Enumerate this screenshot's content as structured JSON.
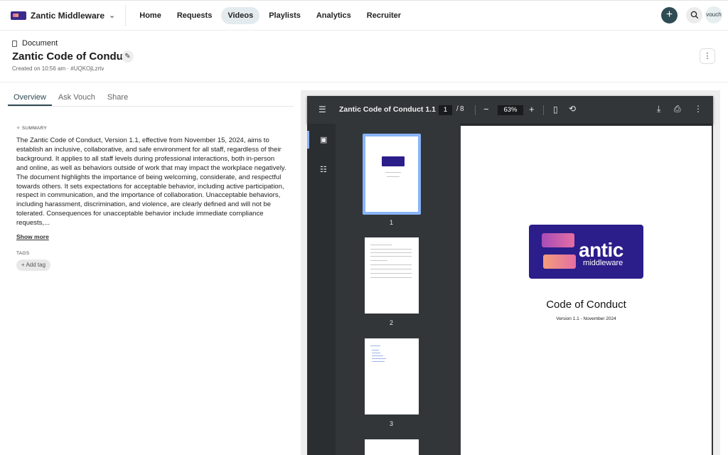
{
  "nav": {
    "brand": "Zantic Middleware",
    "links": [
      "Home",
      "Requests",
      "Videos",
      "Playlists",
      "Analytics",
      "Recruiter"
    ],
    "active": "Videos",
    "avatar": "vouch"
  },
  "header": {
    "type_label": "Document",
    "title": "Zantic Code of Conduct",
    "meta": "Created on 10:56 am · #UQKOjLzrtv"
  },
  "tabs": [
    "Overview",
    "Ask Vouch",
    "Share"
  ],
  "summary": {
    "label": "SUMMARY",
    "text": "The Zantic Code of Conduct, Version 1.1, effective from November 15, 2024, aims to establish an inclusive, collaborative, and safe environment for all staff, regardless of their background. It applies to all staff levels during professional interactions, both in-person and online, as well as behaviors outside of work that may impact the workplace negatively. The document highlights the importance of being welcoming, considerate, and respectful towards others. It sets expectations for acceptable behavior, including active participation, respect in communication, and the importance of collaboration. Unacceptable behaviors, including harassment, discrimination, and violence, are clearly defined and will not be tolerated. Consequences for unacceptable behavior include immediate compliance requests,...",
    "show_more": "Show more"
  },
  "tags": {
    "label": "TAGS",
    "add_tag": "Add tag"
  },
  "viewer": {
    "title": "Zantic Code of Conduct 1.1",
    "current_page": "1",
    "separator": "/",
    "total_pages": "8",
    "zoom": "63%",
    "thumbnail_numbers": [
      "1",
      "2",
      "3"
    ],
    "page": {
      "logo_word": "antic",
      "logo_sub": "middleware",
      "title": "Code of Conduct",
      "subtitle": "Version 1.1 - November 2024"
    }
  }
}
